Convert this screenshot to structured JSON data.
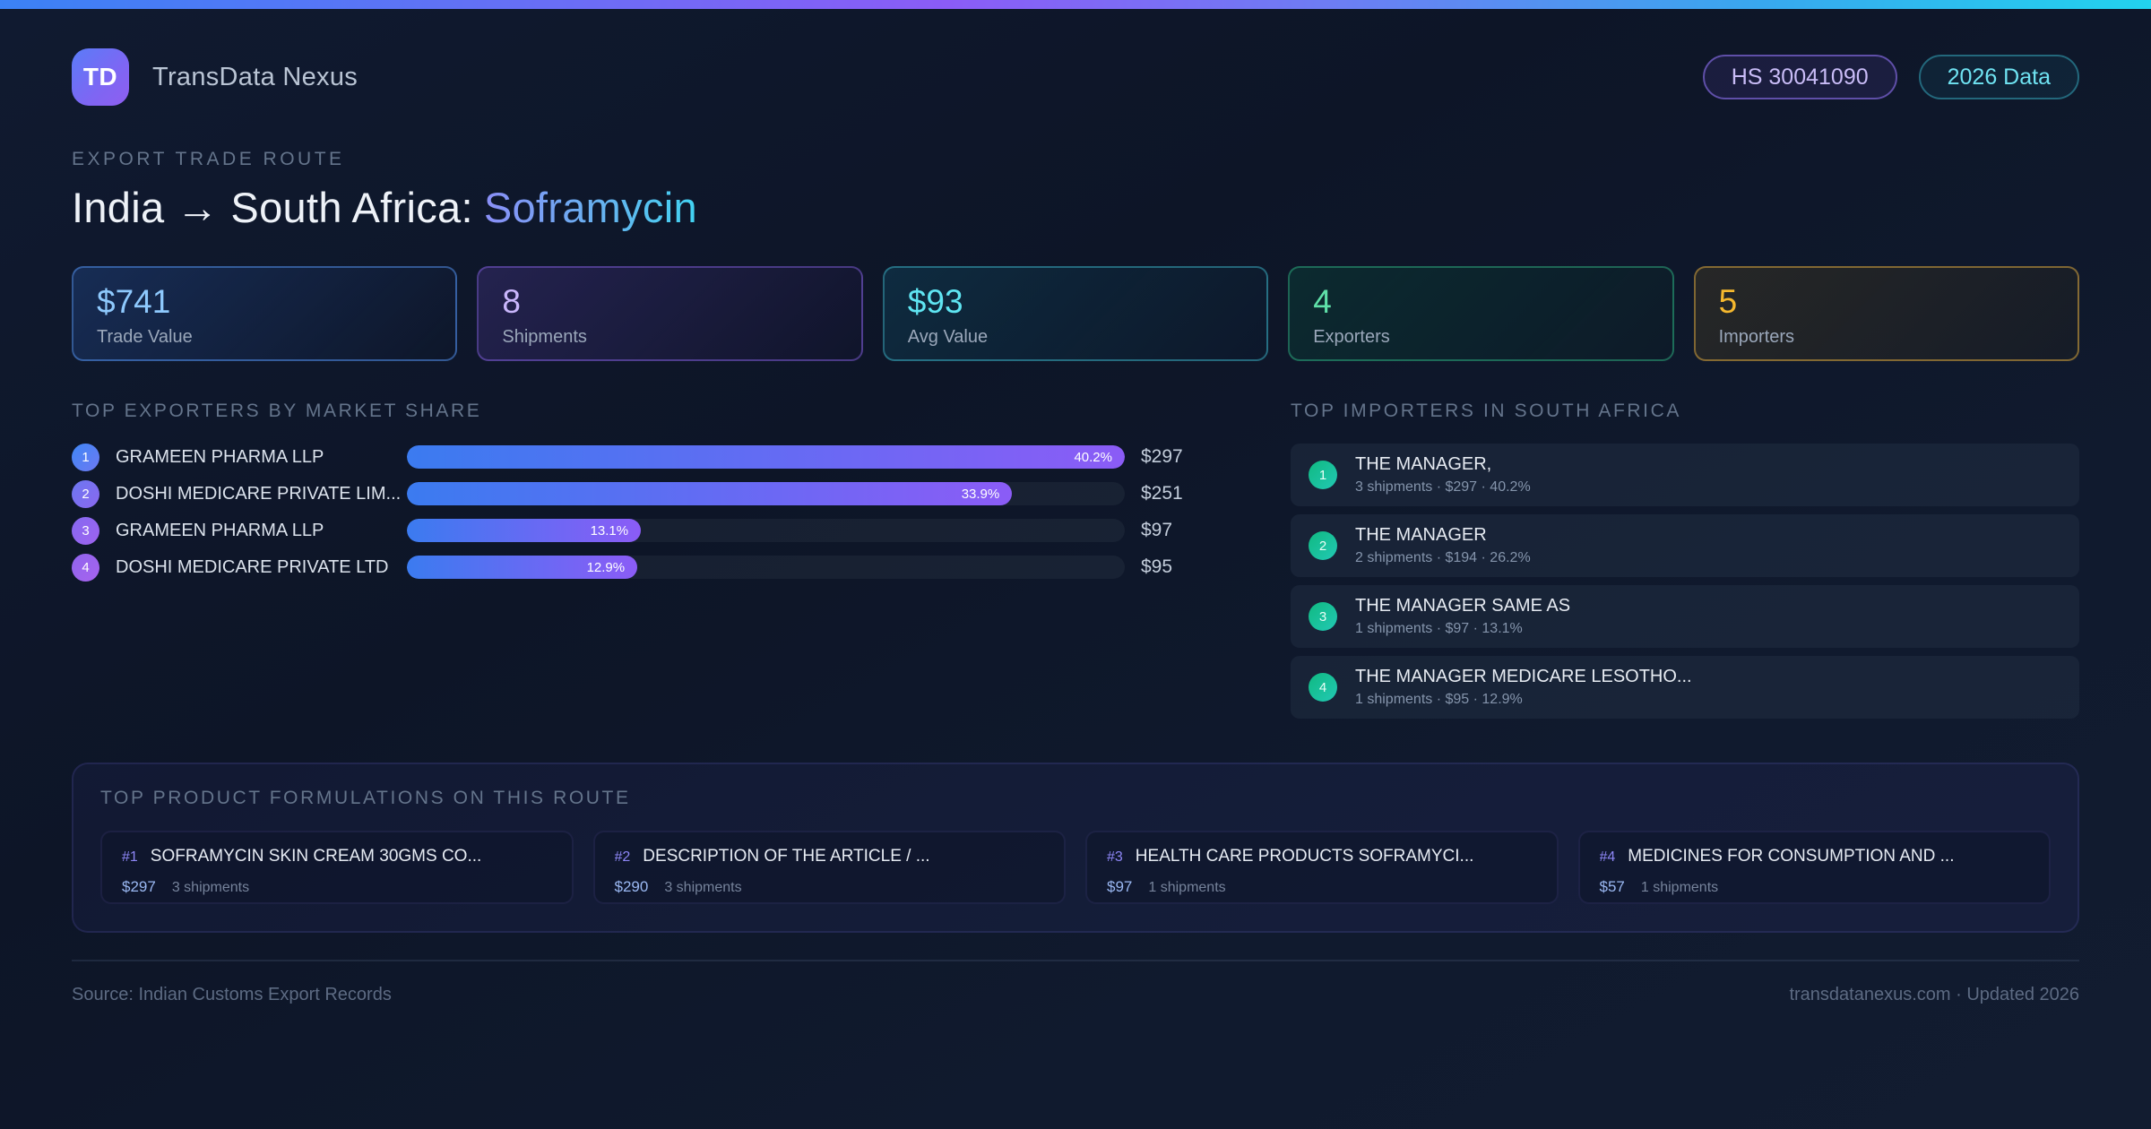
{
  "header": {
    "logo_text": "TD",
    "app_name": "TransData Nexus",
    "badges": {
      "hs_code": "HS 30041090",
      "year": "2026 Data"
    }
  },
  "hero": {
    "eyebrow": "EXPORT TRADE ROUTE",
    "title_prefix": "India → South Africa:",
    "title_highlight": "Soframycin"
  },
  "stats": [
    {
      "value": "$741",
      "label": "Trade Value",
      "accent": "#8ec9fd"
    },
    {
      "value": "8",
      "label": "Shipments",
      "accent": "#c9b6fb"
    },
    {
      "value": "$93",
      "label": "Avg Value",
      "accent": "#5fe5f2"
    },
    {
      "value": "4",
      "label": "Exporters",
      "accent": "#5fe0a8"
    },
    {
      "value": "5",
      "label": "Importers",
      "accent": "#f5b82e"
    }
  ],
  "exporters": {
    "heading": "TOP EXPORTERS BY MARKET SHARE",
    "rows": [
      {
        "rank": "1",
        "name": "GRAMEEN PHARMA LLP",
        "share_label": "40.2%",
        "share_pct": 40.2,
        "bar_width_pct": 100,
        "value": "$297"
      },
      {
        "rank": "2",
        "name": "DOSHI MEDICARE PRIVATE LIM...",
        "share_label": "33.9%",
        "share_pct": 33.9,
        "bar_width_pct": 84.3,
        "value": "$251"
      },
      {
        "rank": "3",
        "name": "GRAMEEN PHARMA LLP",
        "share_label": "13.1%",
        "share_pct": 13.1,
        "bar_width_pct": 32.6,
        "value": "$97"
      },
      {
        "rank": "4",
        "name": "DOSHI MEDICARE PRIVATE LTD",
        "share_label": "12.9%",
        "share_pct": 12.9,
        "bar_width_pct": 32.1,
        "value": "$95"
      }
    ]
  },
  "importers": {
    "heading": "TOP IMPORTERS IN SOUTH AFRICA",
    "rows": [
      {
        "rank": "1",
        "name": "THE MANAGER,",
        "detail": "3 shipments · $297 · 40.2%"
      },
      {
        "rank": "2",
        "name": "THE MANAGER",
        "detail": "2 shipments · $194 · 26.2%"
      },
      {
        "rank": "3",
        "name": "THE MANAGER SAME AS",
        "detail": "1 shipments · $97 · 13.1%"
      },
      {
        "rank": "4",
        "name": "THE MANAGER MEDICARE LESOTHO...",
        "detail": "1 shipments · $95 · 12.9%"
      }
    ]
  },
  "products": {
    "heading": "TOP PRODUCT FORMULATIONS ON THIS ROUTE",
    "cards": [
      {
        "rank": "#1",
        "name": "SOFRAMYCIN SKIN CREAM 30GMS CO...",
        "value": "$297",
        "shipments": "3 shipments"
      },
      {
        "rank": "#2",
        "name": "DESCRIPTION OF THE ARTICLE / ...",
        "value": "$290",
        "shipments": "3 shipments"
      },
      {
        "rank": "#3",
        "name": "HEALTH CARE PRODUCTS SOFRAMYCI...",
        "value": "$97",
        "shipments": "1 shipments"
      },
      {
        "rank": "#4",
        "name": "MEDICINES FOR CONSUMPTION AND ...",
        "value": "$57",
        "shipments": "1 shipments"
      }
    ]
  },
  "footer": {
    "source": "Source: Indian Customs Export Records",
    "site": "transdatanexus.com · Updated 2026"
  },
  "chart_data": {
    "type": "bar",
    "title": "TOP EXPORTERS BY MARKET SHARE",
    "categories": [
      "GRAMEEN PHARMA LLP",
      "DOSHI MEDICARE PRIVATE LIM...",
      "GRAMEEN PHARMA LLP",
      "DOSHI MEDICARE PRIVATE LTD"
    ],
    "series": [
      {
        "name": "market_share_pct",
        "values": [
          40.2,
          33.9,
          13.1,
          12.9
        ]
      },
      {
        "name": "trade_value_usd",
        "values": [
          297,
          251,
          97,
          95
        ]
      }
    ],
    "orientation": "horizontal",
    "xlim": [
      0,
      40.2
    ],
    "grid": false,
    "legend": false
  }
}
